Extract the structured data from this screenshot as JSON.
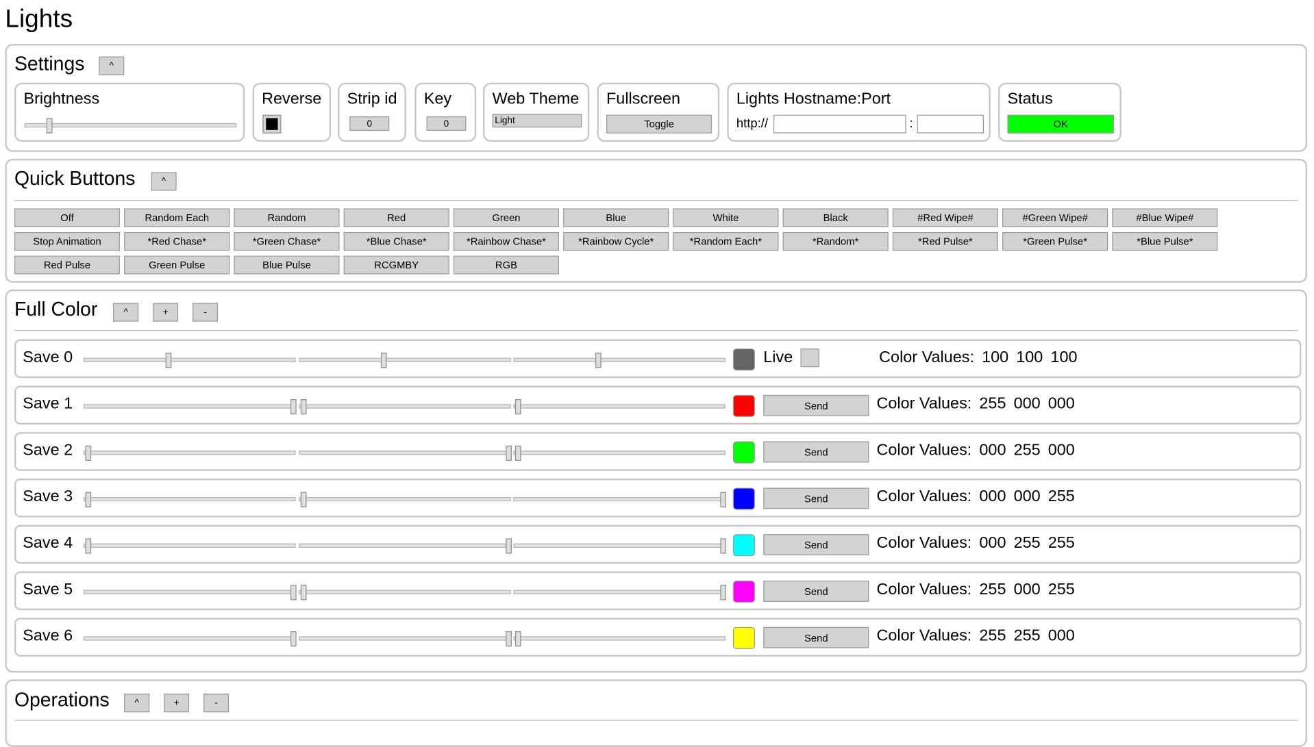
{
  "app_title": "Lights",
  "settings": {
    "heading": "Settings",
    "collapse_label": "^",
    "brightness": {
      "label": "Brightness",
      "value": 0.11
    },
    "reverse": {
      "label": "Reverse"
    },
    "strip_id": {
      "label": "Strip id",
      "value": "0"
    },
    "key": {
      "label": "Key",
      "value": "0"
    },
    "web_theme": {
      "label": "Web Theme",
      "value": "Light"
    },
    "fullscreen": {
      "label": "Fullscreen",
      "button": "Toggle"
    },
    "hostname": {
      "label": "Lights Hostname:Port",
      "prefix": "http://",
      "separator": ":",
      "host_value": "",
      "port_value": ""
    },
    "status": {
      "label": "Status",
      "value": "OK",
      "color": "#00ff00"
    }
  },
  "quick_buttons": {
    "heading": "Quick Buttons",
    "collapse_label": "^",
    "rows": [
      [
        "Off",
        "Random Each",
        "Random",
        "Red",
        "Green",
        "Blue",
        "White",
        "Black",
        "#Red Wipe#",
        "#Green Wipe#",
        "#Blue Wipe#"
      ],
      [
        "Stop Animation",
        "*Red Chase*",
        "*Green Chase*",
        "*Blue Chase*",
        "*Rainbow Chase*",
        "*Rainbow Cycle*",
        "*Random Each*",
        "*Random*",
        "*Red Pulse*",
        "*Green Pulse*",
        "*Blue Pulse*"
      ],
      [
        "Red Pulse",
        "Green Pulse",
        "Blue Pulse",
        "RCGMBY",
        "RGB"
      ]
    ]
  },
  "full_color": {
    "heading": "Full Color",
    "collapse_label": "^",
    "add_label": "+",
    "remove_label": "-",
    "color_values_label": "Color Values:",
    "live_label": "Live",
    "send_label": "Send",
    "saves": [
      {
        "label": "Save 0",
        "r": 100,
        "g": 100,
        "b": 100,
        "r_text": "100",
        "g_text": "100",
        "b_text": "100",
        "swatch": "#646464",
        "live": true
      },
      {
        "label": "Save 1",
        "r": 255,
        "g": 0,
        "b": 0,
        "r_text": "255",
        "g_text": "000",
        "b_text": "000",
        "swatch": "#ff0000"
      },
      {
        "label": "Save 2",
        "r": 0,
        "g": 255,
        "b": 0,
        "r_text": "000",
        "g_text": "255",
        "b_text": "000",
        "swatch": "#00ff00"
      },
      {
        "label": "Save 3",
        "r": 0,
        "g": 0,
        "b": 255,
        "r_text": "000",
        "g_text": "000",
        "b_text": "255",
        "swatch": "#0000ff"
      },
      {
        "label": "Save 4",
        "r": 0,
        "g": 255,
        "b": 255,
        "r_text": "000",
        "g_text": "255",
        "b_text": "255",
        "swatch": "#00ffff"
      },
      {
        "label": "Save 5",
        "r": 255,
        "g": 0,
        "b": 255,
        "r_text": "255",
        "g_text": "000",
        "b_text": "255",
        "swatch": "#ff00ff"
      },
      {
        "label": "Save 6",
        "r": 255,
        "g": 255,
        "b": 0,
        "r_text": "255",
        "g_text": "255",
        "b_text": "000",
        "swatch": "#ffff00"
      }
    ]
  },
  "operations": {
    "heading": "Operations",
    "collapse_label": "^",
    "add_label": "+",
    "remove_label": "-"
  }
}
